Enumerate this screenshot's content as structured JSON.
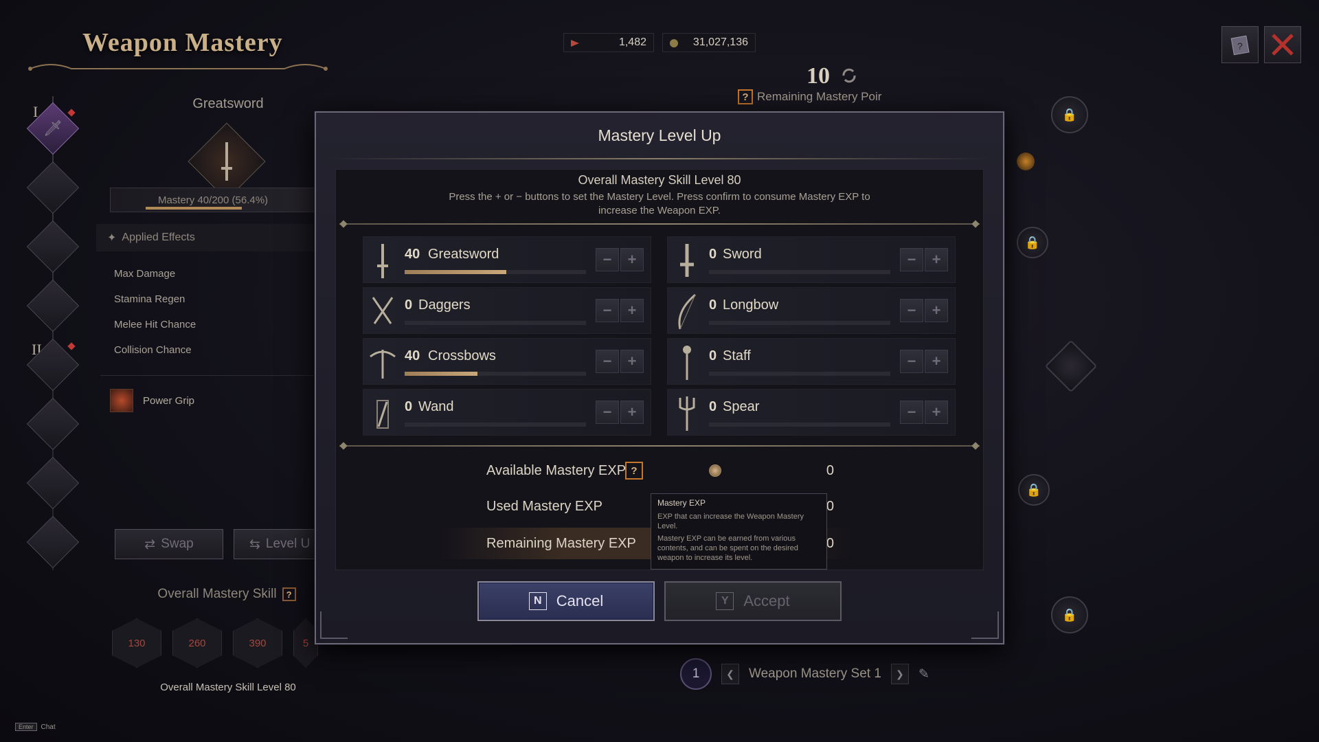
{
  "header": {
    "title": "Weapon Mastery",
    "currency_1": "1,482",
    "currency_2": "31,027,136",
    "remaining_points": "10",
    "remaining_label": "Remaining Mastery Poir"
  },
  "left": {
    "weapon_name": "Greatsword",
    "mastery_text": "Mastery 40/200 (56.4%)",
    "mastery_progress": 0.564,
    "rail_roman_1": "I",
    "rail_roman_2": "II",
    "applied_effects_label": "Applied Effects",
    "effects": [
      "Max Damage",
      "Stamina Regen",
      "Melee Hit Chance",
      "Collision Chance"
    ],
    "skill_name": "Power Grip",
    "swap_label": "Swap",
    "level_label": "Level U",
    "overall_label": "Overall Mastery Skill",
    "milestones": [
      "130",
      "260",
      "390",
      "5"
    ],
    "overall_level": "Overall Mastery Skill Level 80"
  },
  "chat": {
    "key": "Enter",
    "label": "Chat"
  },
  "set": {
    "number": "1",
    "label": "Weapon Mastery Set 1"
  },
  "modal": {
    "title": "Mastery Level Up",
    "overall": "Overall Mastery Skill Level 80",
    "desc_line1": "Press the + or − buttons to set the Mastery Level. Press confirm to consume Mastery EXP to",
    "desc_line2": "increase the Weapon EXP.",
    "weapons": [
      {
        "level": "40",
        "name": "Greatsword",
        "progress": 0.56,
        "icon": "greatsword-icon"
      },
      {
        "level": "0",
        "name": "Sword",
        "progress": 0,
        "icon": "sword-icon"
      },
      {
        "level": "0",
        "name": "Daggers",
        "progress": 0,
        "icon": "daggers-icon"
      },
      {
        "level": "0",
        "name": "Longbow",
        "progress": 0,
        "icon": "longbow-icon"
      },
      {
        "level": "40",
        "name": "Crossbows",
        "progress": 0.4,
        "icon": "crossbow-icon"
      },
      {
        "level": "0",
        "name": "Staff",
        "progress": 0,
        "icon": "staff-icon"
      },
      {
        "level": "0",
        "name": "Wand",
        "progress": 0,
        "icon": "wand-icon"
      },
      {
        "level": "0",
        "name": "Spear",
        "progress": 0,
        "icon": "spear-icon"
      }
    ],
    "available_label": "Available Mastery EXP",
    "available_value": "0",
    "used_label": "Used Mastery EXP",
    "used_value": "0",
    "remaining_label": "Remaining Mastery EXP",
    "remaining_value": "0",
    "tooltip_title": "Mastery EXP",
    "tooltip_p1": "EXP that can increase the Weapon Mastery Level.",
    "tooltip_p2": "Mastery EXP can be earned from various contents, and can be spent on the desired weapon to increase its level.",
    "cancel_key": "N",
    "cancel_label": "Cancel",
    "accept_key": "Y",
    "accept_label": "Accept"
  },
  "colors": {
    "accent_gold": "#c9b089",
    "cancel_blue": "#2e3356",
    "question_orange": "#c7772c"
  }
}
